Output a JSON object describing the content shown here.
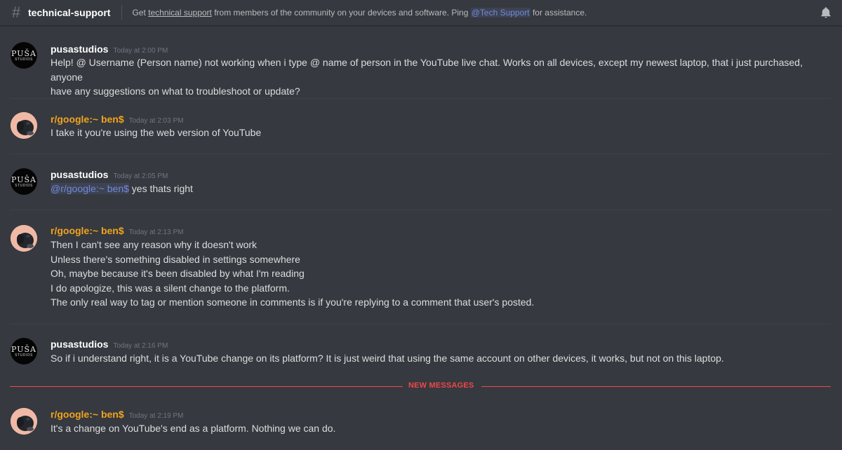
{
  "header": {
    "channel": "technical-support",
    "topic_prefix": "Get ",
    "topic_link": "technical support",
    "topic_middle": " from members of the community on your devices and software. Ping ",
    "topic_mention": "@Tech Support",
    "topic_suffix": " for assistance."
  },
  "avatars": {
    "pusa_line1": "PUŠA",
    "pusa_line2": "STUDIOS"
  },
  "messages": [
    {
      "author": "pusastudios",
      "timestamp": "Today at 2:00 PM",
      "lines": [
        "Help! @ Username (Person name) not working when i type @ name of person in the YouTube live chat. Works on all devices, except my newest laptop, that i just purchased, anyone",
        "have any suggestions on what to troubleshoot or update?"
      ]
    },
    {
      "author": "r/google:~ ben$",
      "timestamp": "Today at 2:03 PM",
      "lines": [
        "I take it you're using the web version of YouTube"
      ]
    },
    {
      "author": "pusastudios",
      "timestamp": "Today at 2:05 PM",
      "mention": "@r/google:~ ben$",
      "lines": [
        " yes thats right"
      ]
    },
    {
      "author": "r/google:~ ben$",
      "timestamp": "Today at 2:13 PM",
      "lines": [
        "Then I can't see any reason why it doesn't work",
        "Unless there's something disabled in settings somewhere",
        "Oh, maybe because it's been disabled by what I'm reading",
        "I do apologize, this was a silent change to the platform.",
        "The only real way to tag or mention someone in comments is if you're replying to a comment that user's posted."
      ]
    },
    {
      "author": "pusastudios",
      "timestamp": "Today at 2:16 PM",
      "lines": [
        "So if i understand right, it is a YouTube change on its platform? It is just weird that using the same account on other devices, it works, but not on this laptop."
      ]
    },
    {
      "author": "r/google:~ ben$",
      "timestamp": "Today at 2:19 PM",
      "lines": [
        "It's a change on YouTube's end as a platform. Nothing we can do."
      ]
    }
  ],
  "new_messages_label": "NEW MESSAGES",
  "colors": {
    "background": "#36393f",
    "ben_username": "#f0a41c",
    "mention": "#7289da",
    "new_messages": "#f04747"
  }
}
